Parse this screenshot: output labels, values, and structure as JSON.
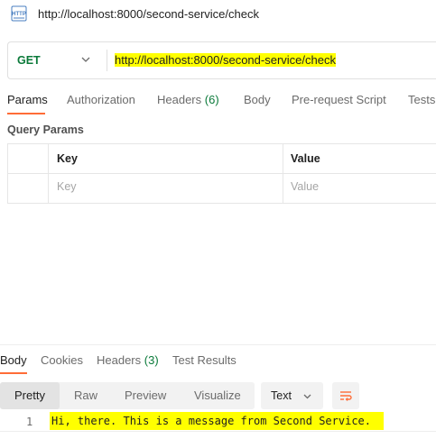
{
  "request": {
    "icon": "http-file-icon",
    "title": "http://localhost:8000/second-service/check",
    "method": "GET",
    "url": "http://localhost:8000/second-service/check"
  },
  "request_tabs": [
    {
      "label": "Params"
    },
    {
      "label": "Authorization"
    },
    {
      "label": "Headers",
      "count": "(6)"
    },
    {
      "label": "Body"
    },
    {
      "label": "Pre-request Script"
    },
    {
      "label": "Tests"
    }
  ],
  "query_params": {
    "title": "Query Params",
    "columns": [
      "Key",
      "Value"
    ],
    "placeholders": [
      "Key",
      "Value"
    ]
  },
  "response_tabs": [
    {
      "label": "Body"
    },
    {
      "label": "Cookies"
    },
    {
      "label": "Headers",
      "count": "(3)"
    },
    {
      "label": "Test Results"
    }
  ],
  "view_modes": [
    "Pretty",
    "Raw",
    "Preview",
    "Visualize"
  ],
  "format": "Text",
  "response": {
    "line_number": "1",
    "text": "Hi, there. This is a message from Second Service."
  },
  "colors": {
    "accent": "#ff6c37",
    "method_get": "#0b7a3a",
    "highlight": "#ffff00"
  }
}
